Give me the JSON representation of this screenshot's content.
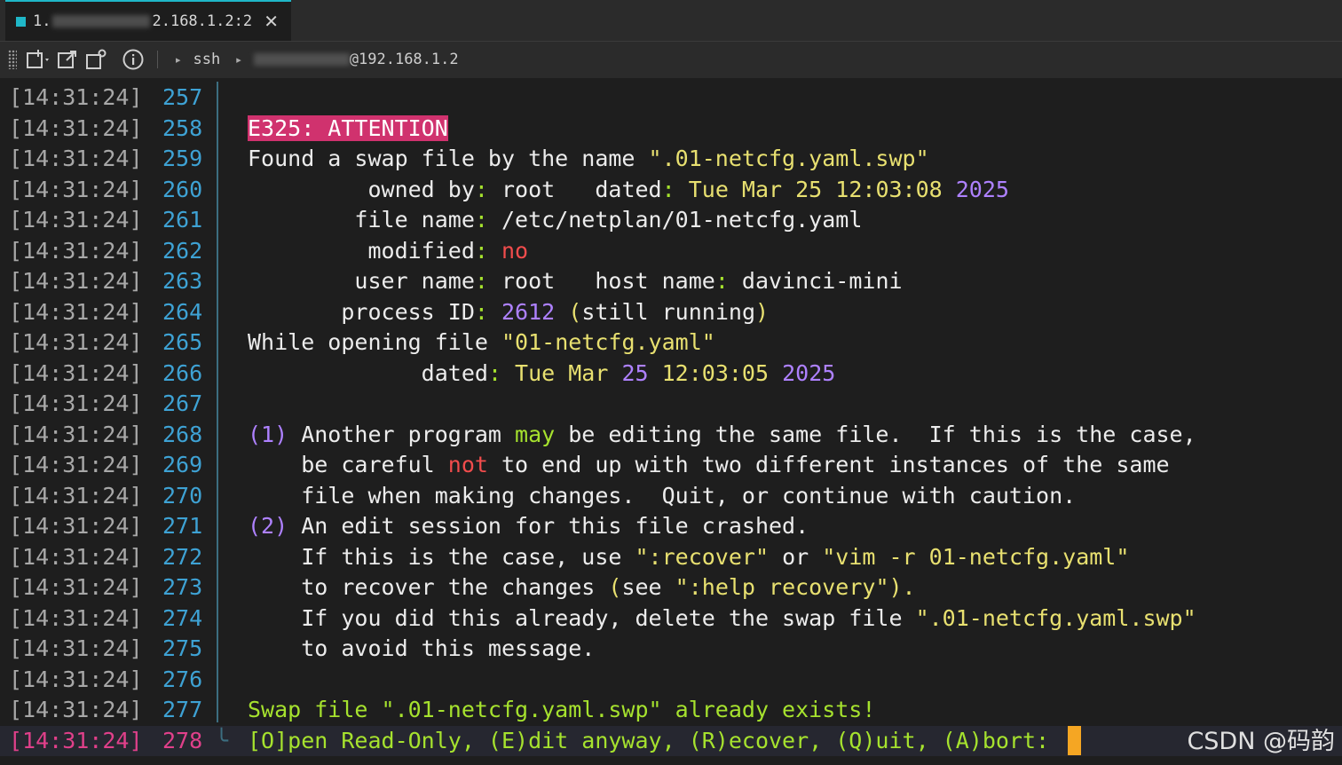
{
  "tab": {
    "prefix": "1.",
    "title_suffix": "2.168.1.2:2",
    "close": "✕"
  },
  "toolbar": {
    "crumb_ssh": "ssh",
    "crumb_host_suffix": "@192.168.1.2"
  },
  "terminal": {
    "timestamp": "[14:31:24]",
    "lines": [
      {
        "n": "257"
      },
      {
        "n": "258"
      },
      {
        "n": "259"
      },
      {
        "n": "260"
      },
      {
        "n": "261"
      },
      {
        "n": "262"
      },
      {
        "n": "263"
      },
      {
        "n": "264"
      },
      {
        "n": "265"
      },
      {
        "n": "266"
      },
      {
        "n": "267"
      },
      {
        "n": "268"
      },
      {
        "n": "269"
      },
      {
        "n": "270"
      },
      {
        "n": "271"
      },
      {
        "n": "272"
      },
      {
        "n": "273"
      },
      {
        "n": "274"
      },
      {
        "n": "275"
      },
      {
        "n": "276"
      },
      {
        "n": "277"
      },
      {
        "n": "278"
      }
    ],
    "text": {
      "attention": "E325: ATTENTION",
      "found_a": "Found a swap file by the name ",
      "found_b": "\".01-netcfg.yaml.swp\"",
      "owned_lbl": "         owned by",
      "colon": ":",
      "owned_val": " root   dated",
      "date1_a": " Tue Mar 25 12:03:08 ",
      "date1_year": "2025",
      "file_lbl": "        file name",
      "file_val": " /etc/netplan/01-netcfg.yaml",
      "mod_lbl": "         modified",
      "mod_val": " no",
      "user_lbl": "        user name",
      "user_val": " root   host name",
      "host_val": " davinci-mini",
      "proc_lbl": "       process ID",
      "proc_sp": " ",
      "proc_pid": "2612",
      "proc_paren_o": " (",
      "proc_still": "still running",
      "proc_paren_c": ")",
      "while_a": "While opening file ",
      "while_b": "\"01-netcfg.yaml\"",
      "dated_lbl": "             dated",
      "date2_a": " Tue Mar ",
      "date2_d": "25",
      "date2_b": " 12:03:05 ",
      "date2_year": "2025",
      "p1_num": "(1)",
      "p1_a": " Another program ",
      "p1_may": "may",
      "p1_b": " be editing the same file.  If this is the case,",
      "p1_l2a": "    be careful ",
      "p1_not": "not",
      "p1_l2b": " to end up with two different instances of the same",
      "p1_l3": "    file when making changes.  Quit, or continue with caution.",
      "p2_num": "(2)",
      "p2_a": " An edit session for this file crashed.",
      "p2_l2a": "    If this is the case, use ",
      "p2_rec": "\":recover\"",
      "p2_or": " or ",
      "p2_vim": "\"vim -r 01-netcfg.yaml\"",
      "p2_l3a": "    to recover the changes ",
      "p2_paren": "(",
      "p2_see": "see ",
      "p2_help": "\":help recovery\"",
      "p2_close": ").",
      "p2_l4a": "    If you did this already, delete the swap file ",
      "p2_swp": "\".01-netcfg.yaml.swp\"",
      "p2_l5": "    to avoid this message.",
      "swap_exists": "Swap file \".01-netcfg.yaml.swp\" already exists!",
      "prompt": "[O]pen Read-Only, (E)dit anyway, (R)ecover, (Q)uit, (A)bort: "
    }
  },
  "watermark": "CSDN @码韵",
  "colors": {
    "accent": "#1fb7c8",
    "attention_bg": "#d0326e",
    "cursor": "#f5a623",
    "line_number": "#3ea2d4"
  }
}
